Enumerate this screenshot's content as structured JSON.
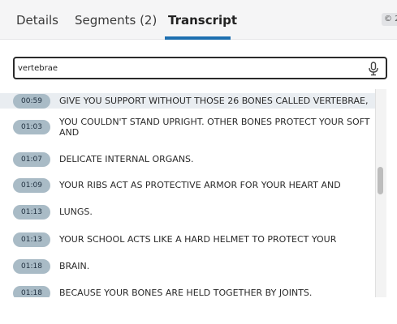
{
  "tabs": [
    {
      "label": "Details",
      "active": false
    },
    {
      "label": "Segments (2)",
      "active": false
    },
    {
      "label": "Transcript",
      "active": true
    }
  ],
  "copyright_chip": "© 2",
  "search": {
    "value": "vertebrae",
    "placeholder": ""
  },
  "mic_icon": "microphone-icon",
  "accent_color": "#1e6fb0",
  "timestamp_color": "#a9bbc6",
  "transcript": [
    {
      "time": "00:59",
      "text": "GIVE YOU SUPPORT WITHOUT THOSE 26 BONES CALLED VERTEBRAE,",
      "highlighted": true
    },
    {
      "time": "01:03",
      "text": "YOU COULDN'T STAND UPRIGHT. OTHER BONES PROTECT YOUR SOFT AND",
      "highlighted": false
    },
    {
      "time": "01:07",
      "text": "DELICATE INTERNAL ORGANS.",
      "highlighted": false
    },
    {
      "time": "01:09",
      "text": "YOUR RIBS ACT AS PROTECTIVE ARMOR FOR YOUR HEART AND",
      "highlighted": false
    },
    {
      "time": "01:13",
      "text": "LUNGS.",
      "highlighted": false
    },
    {
      "time": "01:13",
      "text": "YOUR SCHOOL ACTS LIKE A HARD HELMET TO PROTECT YOUR",
      "highlighted": false
    },
    {
      "time": "01:18",
      "text": "BRAIN.",
      "highlighted": false
    },
    {
      "time": "01:18",
      "text": "BECAUSE YOUR BONES ARE HELD TOGETHER BY JOINTS.",
      "highlighted": false
    }
  ]
}
